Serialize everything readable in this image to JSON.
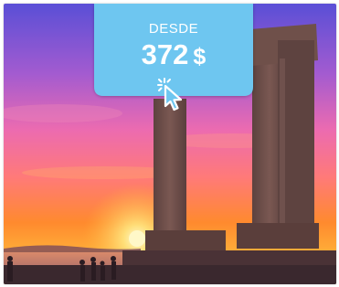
{
  "offer": {
    "label": "DESDE",
    "price": "372",
    "currency": "$"
  },
  "icons": {
    "pointer": "click-pointer-icon"
  },
  "colors": {
    "badge": "#6ec6f0",
    "badge_text": "#ffffff",
    "sky_top": "#5a4fd6",
    "sky_horizon": "#ff8a2e",
    "sun": "#fff4b0",
    "stone": "#6a4a45"
  }
}
